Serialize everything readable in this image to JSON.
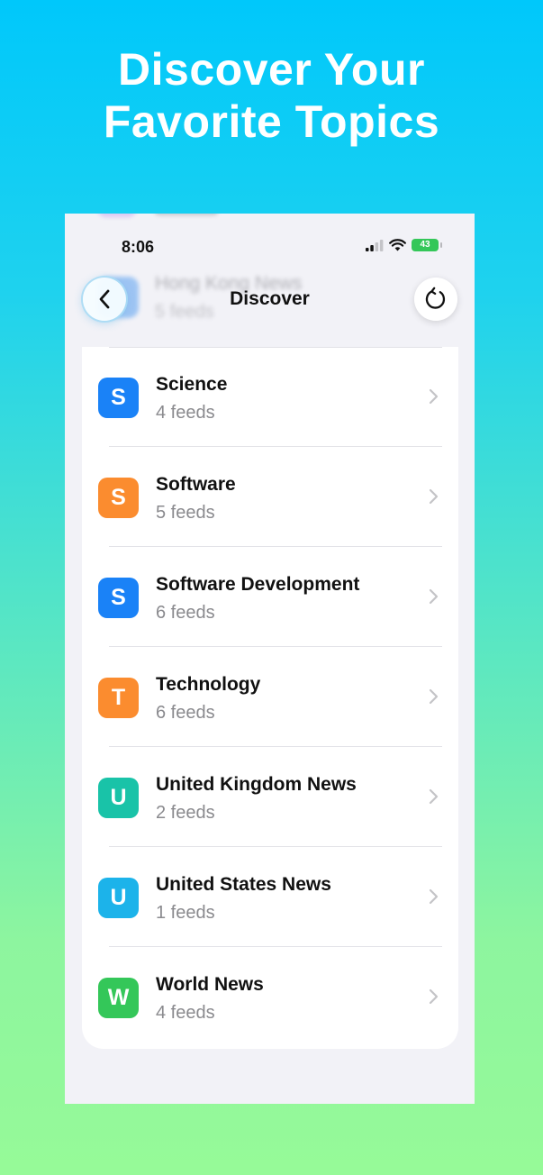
{
  "promo": {
    "headline_line1": "Discover Your",
    "headline_line2": "Favorite Topics"
  },
  "status_bar": {
    "time": "8:06",
    "battery": "43"
  },
  "nav": {
    "title": "Discover",
    "back_icon": "chevron-left-icon",
    "refresh_icon": "refresh-icon"
  },
  "scrolled_behind": {
    "title": "Hong Kong News",
    "subtitle": "5 feeds"
  },
  "colors": {
    "blue": "#1a82f7",
    "orange": "#fb8c2f",
    "teal": "#19c3a8",
    "cyan": "#1cb3ea",
    "green": "#34c759"
  },
  "topics": [
    {
      "letter": "S",
      "name": "Science",
      "count": "4 feeds",
      "color": "#1a82f7"
    },
    {
      "letter": "S",
      "name": "Software",
      "count": "5 feeds",
      "color": "#fb8c2f"
    },
    {
      "letter": "S",
      "name": "Software Development",
      "count": "6 feeds",
      "color": "#1a82f7"
    },
    {
      "letter": "T",
      "name": "Technology",
      "count": "6 feeds",
      "color": "#fb8c2f"
    },
    {
      "letter": "U",
      "name": "United Kingdom News",
      "count": "2 feeds",
      "color": "#19c3a8"
    },
    {
      "letter": "U",
      "name": "United States News",
      "count": "1 feeds",
      "color": "#1cb3ea"
    },
    {
      "letter": "W",
      "name": "World News",
      "count": "4 feeds",
      "color": "#34c759"
    }
  ]
}
